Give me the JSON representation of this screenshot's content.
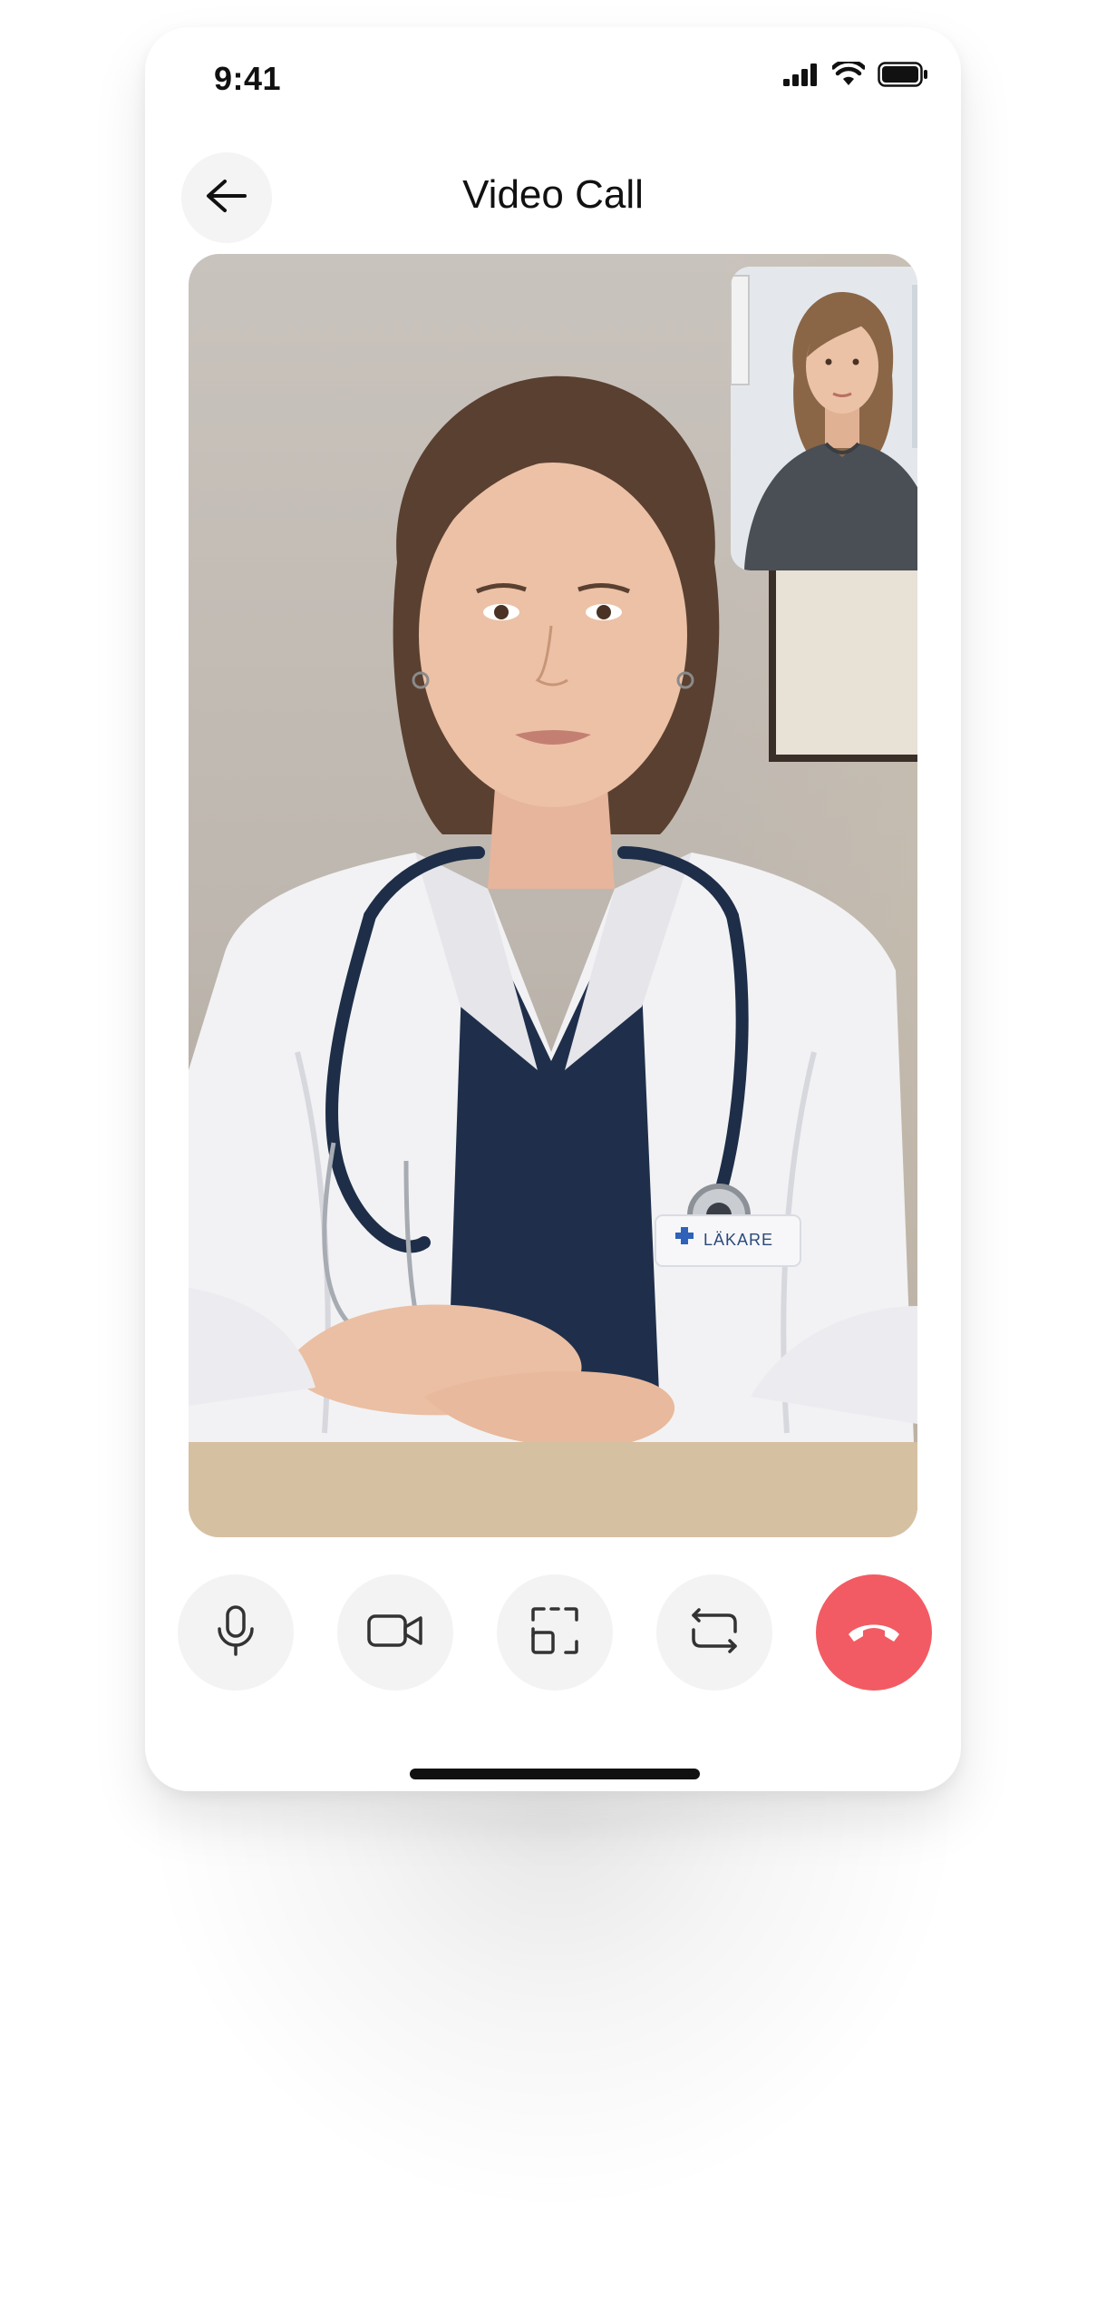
{
  "status_bar": {
    "time": "9:41",
    "icons": [
      "signal-icon",
      "wifi-icon",
      "battery-icon"
    ]
  },
  "header": {
    "title": "Video Call",
    "back_icon": "arrow-left-icon"
  },
  "main_video": {
    "badge_text": "LÄKARE",
    "badge_icon": "medical-cross-icon"
  },
  "controls": {
    "items": [
      {
        "icon": "microphone-icon"
      },
      {
        "icon": "video-camera-icon"
      },
      {
        "icon": "screen-share-icon"
      },
      {
        "icon": "switch-camera-icon"
      },
      {
        "icon": "end-call-icon"
      }
    ]
  },
  "colors": {
    "end_call": "#f25b63",
    "control_bg": "#f3f3f4",
    "badge_cross": "#2f62b8"
  }
}
